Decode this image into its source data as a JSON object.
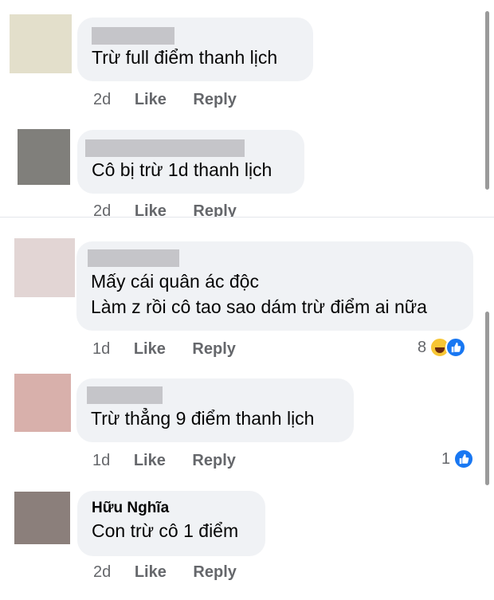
{
  "comments": [
    {
      "name": "",
      "text": "Trừ full điểm thanh lịch",
      "time": "2d",
      "like": "Like",
      "reply": "Reply",
      "reactions": null
    },
    {
      "name": "",
      "text": "Cô bị trừ 1d thanh lịch",
      "time": "2d",
      "like": "Like",
      "reply": "Reply",
      "reactions": null
    },
    {
      "name": "",
      "text_lines": [
        "Mấy cái quân ác độc",
        "Làm z rồi cô tao sao dám trừ điểm ai nữa"
      ],
      "time": "1d",
      "like": "Like",
      "reply": "Reply",
      "reactions": {
        "count": "8",
        "icons": [
          "haha-icon",
          "like-icon"
        ]
      }
    },
    {
      "name": "",
      "text": "Trừ thẳng 9 điểm thanh lịch",
      "time": "1d",
      "like": "Like",
      "reply": "Reply",
      "reactions": {
        "count": "1",
        "icons": [
          "like-icon"
        ]
      }
    },
    {
      "name": "Hữu Nghĩa",
      "text": "Con trừ cô 1 điểm",
      "time": "2d",
      "like": "Like",
      "reply": "Reply",
      "reactions": null
    }
  ],
  "colors": {
    "bubble": "#f0f2f5",
    "secondary_text": "#65676b",
    "like_blue": "#1877f2",
    "haha_yellow": "#f7c634"
  }
}
